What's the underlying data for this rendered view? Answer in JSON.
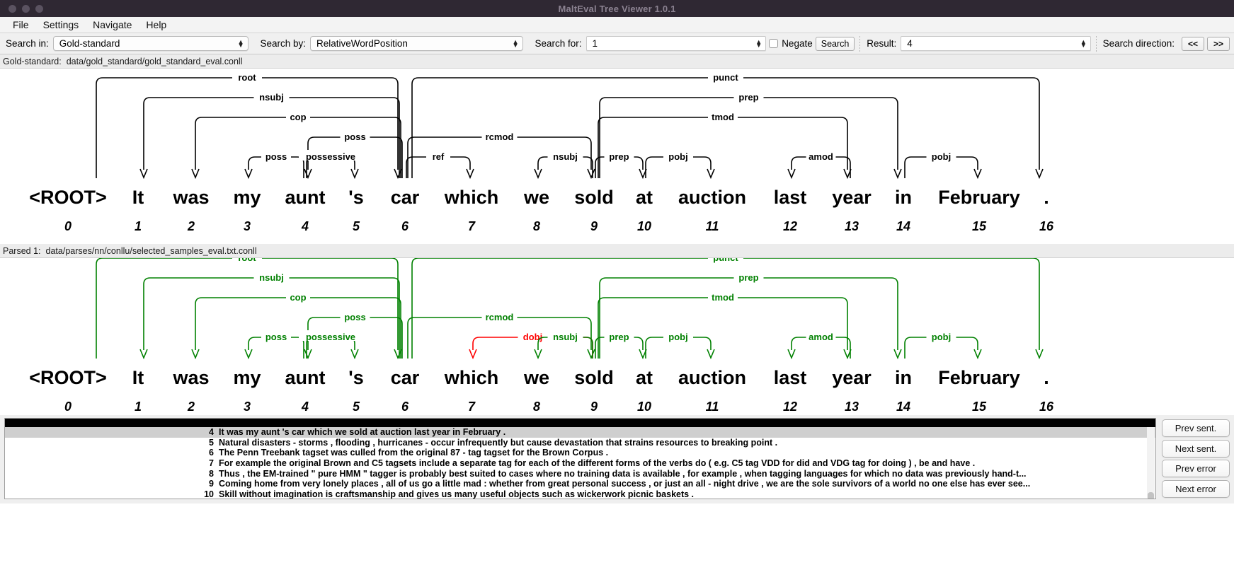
{
  "window": {
    "title": "MaltEval Tree Viewer 1.0.1"
  },
  "menubar": {
    "items": [
      "File",
      "Settings",
      "Navigate",
      "Help"
    ]
  },
  "toolbar": {
    "search_in_label": "Search in:",
    "search_in_value": "Gold-standard",
    "search_by_label": "Search by:",
    "search_by_value": "RelativeWordPosition",
    "search_for_label": "Search for:",
    "search_for_value": "1",
    "negate_label": "Negate",
    "search_button": "Search",
    "result_label": "Result:",
    "result_value": "4",
    "search_direction_label": "Search direction:",
    "prev_dir_button": "<<",
    "next_dir_button": ">>"
  },
  "gold_path_bar": {
    "label": "Gold-standard:",
    "path": "data/gold_standard/gold_standard_eval.conll"
  },
  "parsed_path_bar": {
    "label": "Parsed 1:",
    "path": "data/parses/nn/conllu/selected_samples_eval.txt.conll"
  },
  "colors": {
    "correct": "#008000",
    "error": "#ff0000",
    "neutral": "#000000"
  },
  "tokens": [
    {
      "id": "0",
      "form": "<ROOT>"
    },
    {
      "id": "1",
      "form": "It"
    },
    {
      "id": "2",
      "form": "was"
    },
    {
      "id": "3",
      "form": "my"
    },
    {
      "id": "4",
      "form": "aunt"
    },
    {
      "id": "5",
      "form": "'s"
    },
    {
      "id": "6",
      "form": "car"
    },
    {
      "id": "7",
      "form": "which"
    },
    {
      "id": "8",
      "form": "we"
    },
    {
      "id": "9",
      "form": "sold"
    },
    {
      "id": "10",
      "form": "at"
    },
    {
      "id": "11",
      "form": "auction"
    },
    {
      "id": "12",
      "form": "last"
    },
    {
      "id": "13",
      "form": "year"
    },
    {
      "id": "14",
      "form": "in"
    },
    {
      "id": "15",
      "form": "February"
    },
    {
      "id": "16",
      "form": "."
    }
  ],
  "gold_tree": {
    "arcs": [
      {
        "label": "root",
        "head": 0,
        "dep": 6,
        "level": 5,
        "status": "neutral"
      },
      {
        "label": "nsubj",
        "head": 6,
        "dep": 1,
        "level": 4,
        "status": "neutral"
      },
      {
        "label": "cop",
        "head": 6,
        "dep": 2,
        "level": 3,
        "status": "neutral"
      },
      {
        "label": "poss",
        "head": 6,
        "dep": 4,
        "level": 2,
        "status": "neutral"
      },
      {
        "label": "poss",
        "head": 4,
        "dep": 3,
        "level": 1,
        "status": "neutral"
      },
      {
        "label": "possessive",
        "head": 4,
        "dep": 5,
        "level": 1,
        "status": "neutral"
      },
      {
        "label": "punct",
        "head": 6,
        "dep": 16,
        "level": 5,
        "status": "neutral"
      },
      {
        "label": "rcmod",
        "head": 6,
        "dep": 9,
        "level": 2,
        "status": "neutral"
      },
      {
        "label": "ref",
        "head": 6,
        "dep": 7,
        "level": 1,
        "status": "neutral"
      },
      {
        "label": "nsubj",
        "head": 9,
        "dep": 8,
        "level": 1,
        "status": "neutral"
      },
      {
        "label": "prep",
        "head": 9,
        "dep": 14,
        "level": 4,
        "status": "neutral"
      },
      {
        "label": "tmod",
        "head": 9,
        "dep": 13,
        "level": 3,
        "status": "neutral"
      },
      {
        "label": "prep",
        "head": 9,
        "dep": 10,
        "level": 1,
        "status": "neutral"
      },
      {
        "label": "pobj",
        "head": 10,
        "dep": 11,
        "level": 1,
        "status": "neutral"
      },
      {
        "label": "amod",
        "head": 13,
        "dep": 12,
        "level": 1,
        "status": "neutral"
      },
      {
        "label": "pobj",
        "head": 14,
        "dep": 15,
        "level": 1,
        "status": "neutral"
      }
    ]
  },
  "parsed_tree": {
    "arcs": [
      {
        "label": "root",
        "head": 0,
        "dep": 6,
        "level": 5,
        "status": "correct"
      },
      {
        "label": "nsubj",
        "head": 6,
        "dep": 1,
        "level": 4,
        "status": "correct"
      },
      {
        "label": "cop",
        "head": 6,
        "dep": 2,
        "level": 3,
        "status": "correct"
      },
      {
        "label": "poss",
        "head": 6,
        "dep": 4,
        "level": 2,
        "status": "correct"
      },
      {
        "label": "poss",
        "head": 4,
        "dep": 3,
        "level": 1,
        "status": "correct"
      },
      {
        "label": "possessive",
        "head": 4,
        "dep": 5,
        "level": 1,
        "status": "correct"
      },
      {
        "label": "punct",
        "head": 6,
        "dep": 16,
        "level": 5,
        "status": "correct"
      },
      {
        "label": "rcmod",
        "head": 6,
        "dep": 9,
        "level": 2,
        "status": "correct"
      },
      {
        "label": "dobj",
        "head": 9,
        "dep": 7,
        "level": 1,
        "status": "error"
      },
      {
        "label": "nsubj",
        "head": 9,
        "dep": 8,
        "level": 1,
        "status": "correct"
      },
      {
        "label": "prep",
        "head": 9,
        "dep": 14,
        "level": 4,
        "status": "correct"
      },
      {
        "label": "tmod",
        "head": 9,
        "dep": 13,
        "level": 3,
        "status": "correct"
      },
      {
        "label": "prep",
        "head": 9,
        "dep": 10,
        "level": 1,
        "status": "correct"
      },
      {
        "label": "pobj",
        "head": 10,
        "dep": 11,
        "level": 1,
        "status": "correct"
      },
      {
        "label": "amod",
        "head": 13,
        "dep": 12,
        "level": 1,
        "status": "correct"
      },
      {
        "label": "pobj",
        "head": 14,
        "dep": 15,
        "level": 1,
        "status": "correct"
      }
    ]
  },
  "sentence_list": {
    "rows": [
      {
        "index": "4",
        "text": "It was my aunt 's car which we sold at auction last year in February .",
        "selected": true
      },
      {
        "index": "5",
        "text": "Natural disasters - storms , flooding , hurricanes - occur infrequently but cause devastation that strains resources to breaking point .",
        "selected": false
      },
      {
        "index": "6",
        "text": "The Penn Treebank tagset was culled from the original 87 - tag tagset for the Brown Corpus .",
        "selected": false
      },
      {
        "index": "7",
        "text": "For example the original Brown and C5 tagsets include a separate tag for each of the different forms of the verbs do ( e.g. C5 tag VDD for did and VDG tag for doing ) , be and have .",
        "selected": false
      },
      {
        "index": "8",
        "text": "Thus , the EM-trained \" pure HMM \" tagger is probably best suited to cases where no training data is available , for example , when tagging languages for which no data was previously hand-t...",
        "selected": false
      },
      {
        "index": "9",
        "text": "Coming home from very lonely places , all of us go a little mad : whether from great personal success , or just an all - night drive , we are the sole survivors of a world no one else has ever see...",
        "selected": false
      },
      {
        "index": "10",
        "text": "Skill without imagination is craftsmanship and gives us many useful objects such as wickerwork picnic baskets .",
        "selected": false
      }
    ]
  },
  "side_buttons": {
    "prev_sent": "Prev sent.",
    "next_sent": "Next sent.",
    "prev_error": "Prev error",
    "next_error": "Next error"
  }
}
